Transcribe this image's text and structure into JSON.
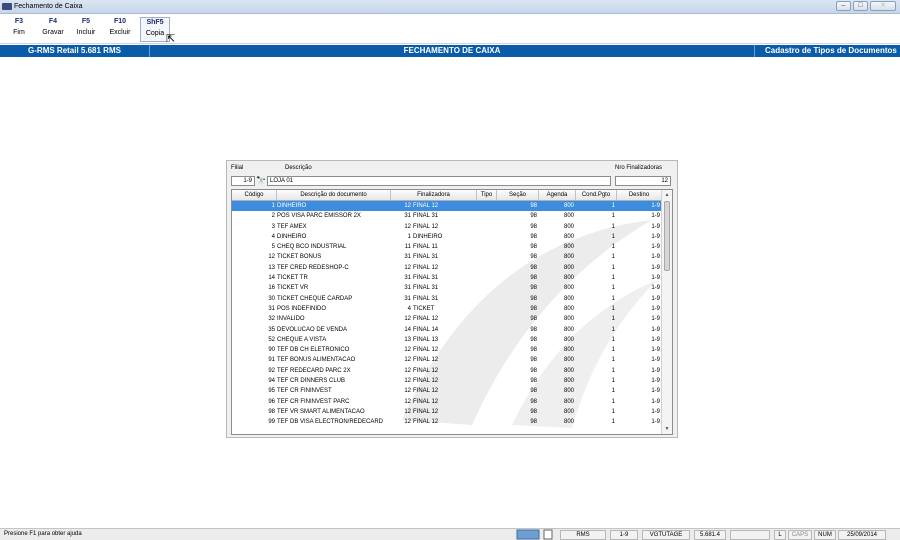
{
  "window": {
    "title": "Fechamento de Caixa"
  },
  "toolbar": [
    {
      "key": "F3",
      "label": "Fim"
    },
    {
      "key": "F4",
      "label": "Gravar"
    },
    {
      "key": "F5",
      "label": "Incluir"
    },
    {
      "key": "F10",
      "label": "Excluir"
    },
    {
      "key": "ShF5",
      "label": "Copia"
    }
  ],
  "header": {
    "app_name": "G-RMS Retail 5.681 RMS",
    "screen_title": "FECHAMENTO DE CAIXA",
    "module": "Cadastro de Tipos de Documentos"
  },
  "filter": {
    "filial_label": "Filial",
    "filial_value": "1-9",
    "descricao_label": "Descrição",
    "descricao_value": "LOJA 01",
    "nro_label": "Nro Finalizadoras",
    "nro_value": "12"
  },
  "table": {
    "columns": [
      "Código",
      "Descrição do documento",
      "Finalizadora",
      "Tipo",
      "Seção",
      "Agenda",
      "Cond.Pgto",
      "Destino"
    ],
    "rows": [
      {
        "codigo": "1",
        "descricao": "DINHEIRO",
        "fin_num": "12",
        "fin_name": "FINAL 12",
        "tipo": "",
        "secao": "98",
        "agenda": "800",
        "cond": "1",
        "destino": "1-9",
        "selected": true
      },
      {
        "codigo": "2",
        "descricao": "POS VISA PARC EMISSOR 2X",
        "fin_num": "31",
        "fin_name": "FINAL 31",
        "tipo": "",
        "secao": "98",
        "agenda": "800",
        "cond": "1",
        "destino": "1-9"
      },
      {
        "codigo": "3",
        "descricao": "TEF AMEX",
        "fin_num": "12",
        "fin_name": "FINAL 12",
        "tipo": "",
        "secao": "98",
        "agenda": "800",
        "cond": "1",
        "destino": "1-9"
      },
      {
        "codigo": "4",
        "descricao": "DINHEIRO",
        "fin_num": "1",
        "fin_name": "DINHEIRO",
        "tipo": "",
        "secao": "98",
        "agenda": "800",
        "cond": "1",
        "destino": "1-9"
      },
      {
        "codigo": "5",
        "descricao": "CHEQ BCO INDUSTRIAL",
        "fin_num": "11",
        "fin_name": "FINAL 11",
        "tipo": "",
        "secao": "98",
        "agenda": "800",
        "cond": "1",
        "destino": "1-9"
      },
      {
        "codigo": "12",
        "descricao": "TICKET BONUS",
        "fin_num": "31",
        "fin_name": "FINAL 31",
        "tipo": "",
        "secao": "98",
        "agenda": "800",
        "cond": "1",
        "destino": "1-9"
      },
      {
        "codigo": "13",
        "descricao": "TEF CRED REDESHOP-C",
        "fin_num": "12",
        "fin_name": "FINAL 12",
        "tipo": "",
        "secao": "98",
        "agenda": "800",
        "cond": "1",
        "destino": "1-9"
      },
      {
        "codigo": "14",
        "descricao": "TICKET TR",
        "fin_num": "31",
        "fin_name": "FINAL 31",
        "tipo": "",
        "secao": "98",
        "agenda": "800",
        "cond": "1",
        "destino": "1-9"
      },
      {
        "codigo": "16",
        "descricao": "TICKET VR",
        "fin_num": "31",
        "fin_name": "FINAL 31",
        "tipo": "",
        "secao": "98",
        "agenda": "800",
        "cond": "1",
        "destino": "1-9"
      },
      {
        "codigo": "30",
        "descricao": "TICKET CHEQUE CARDAP",
        "fin_num": "31",
        "fin_name": "FINAL 31",
        "tipo": "",
        "secao": "98",
        "agenda": "800",
        "cond": "1",
        "destino": "1-9"
      },
      {
        "codigo": "31",
        "descricao": "POS INDEFINIDO",
        "fin_num": "4",
        "fin_name": "TICKET",
        "tipo": "",
        "secao": "98",
        "agenda": "800",
        "cond": "1",
        "destino": "1-9"
      },
      {
        "codigo": "32",
        "descricao": "INVALIDO",
        "fin_num": "12",
        "fin_name": "FINAL 12",
        "tipo": "",
        "secao": "98",
        "agenda": "800",
        "cond": "1",
        "destino": "1-9"
      },
      {
        "codigo": "35",
        "descricao": "DEVOLUCAO DE VENDA",
        "fin_num": "14",
        "fin_name": "FINAL 14",
        "tipo": "",
        "secao": "98",
        "agenda": "800",
        "cond": "1",
        "destino": "1-9"
      },
      {
        "codigo": "52",
        "descricao": "CHEQUE A VISTA",
        "fin_num": "13",
        "fin_name": "FINAL 13",
        "tipo": "",
        "secao": "98",
        "agenda": "800",
        "cond": "1",
        "destino": "1-9"
      },
      {
        "codigo": "90",
        "descricao": "TEF DB CH ELETRONICO",
        "fin_num": "12",
        "fin_name": "FINAL 12",
        "tipo": "",
        "secao": "98",
        "agenda": "800",
        "cond": "1",
        "destino": "1-9"
      },
      {
        "codigo": "91",
        "descricao": "TEF BONUS ALIMENTACAO",
        "fin_num": "12",
        "fin_name": "FINAL 12",
        "tipo": "",
        "secao": "98",
        "agenda": "800",
        "cond": "1",
        "destino": "1-9"
      },
      {
        "codigo": "92",
        "descricao": "TEF REDECARD PARC 2X",
        "fin_num": "12",
        "fin_name": "FINAL 12",
        "tipo": "",
        "secao": "98",
        "agenda": "800",
        "cond": "1",
        "destino": "1-9"
      },
      {
        "codigo": "94",
        "descricao": "TEF CR DINNERS CLUB",
        "fin_num": "12",
        "fin_name": "FINAL 12",
        "tipo": "",
        "secao": "98",
        "agenda": "800",
        "cond": "1",
        "destino": "1-9"
      },
      {
        "codigo": "95",
        "descricao": "TEF CR FININVEST",
        "fin_num": "12",
        "fin_name": "FINAL 12",
        "tipo": "",
        "secao": "98",
        "agenda": "800",
        "cond": "1",
        "destino": "1-9"
      },
      {
        "codigo": "96",
        "descricao": "TEF CR FININVEST PARC",
        "fin_num": "12",
        "fin_name": "FINAL 12",
        "tipo": "",
        "secao": "98",
        "agenda": "800",
        "cond": "1",
        "destino": "1-9"
      },
      {
        "codigo": "98",
        "descricao": "TEF VR SMART ALIMENTACAO",
        "fin_num": "12",
        "fin_name": "FINAL 12",
        "tipo": "",
        "secao": "98",
        "agenda": "800",
        "cond": "1",
        "destino": "1-9"
      },
      {
        "codigo": "99",
        "descricao": "TEF DB VISA ELECTRON/REDECARD",
        "fin_num": "12",
        "fin_name": "FINAL 12",
        "tipo": "",
        "secao": "98",
        "agenda": "800",
        "cond": "1",
        "destino": "1-9"
      }
    ]
  },
  "status": {
    "help": "Presione F1 para obter ajuda",
    "system": "RMS",
    "filial": "1-9",
    "user": "VGTUTAGE",
    "version": "5.681.4",
    "l": "L",
    "caps": "CAPS",
    "num": "NUM",
    "date": "25/09/2014"
  },
  "colors": {
    "header_blue": "#0a5ca8",
    "selected_row": "#3c8de0",
    "toolbar_key": "#1c2a78"
  },
  "icons": [
    "binoculars-icon",
    "cursor-arrow-icon",
    "network-icon",
    "document-icon",
    "scroll-up-icon",
    "scroll-down-icon"
  ]
}
